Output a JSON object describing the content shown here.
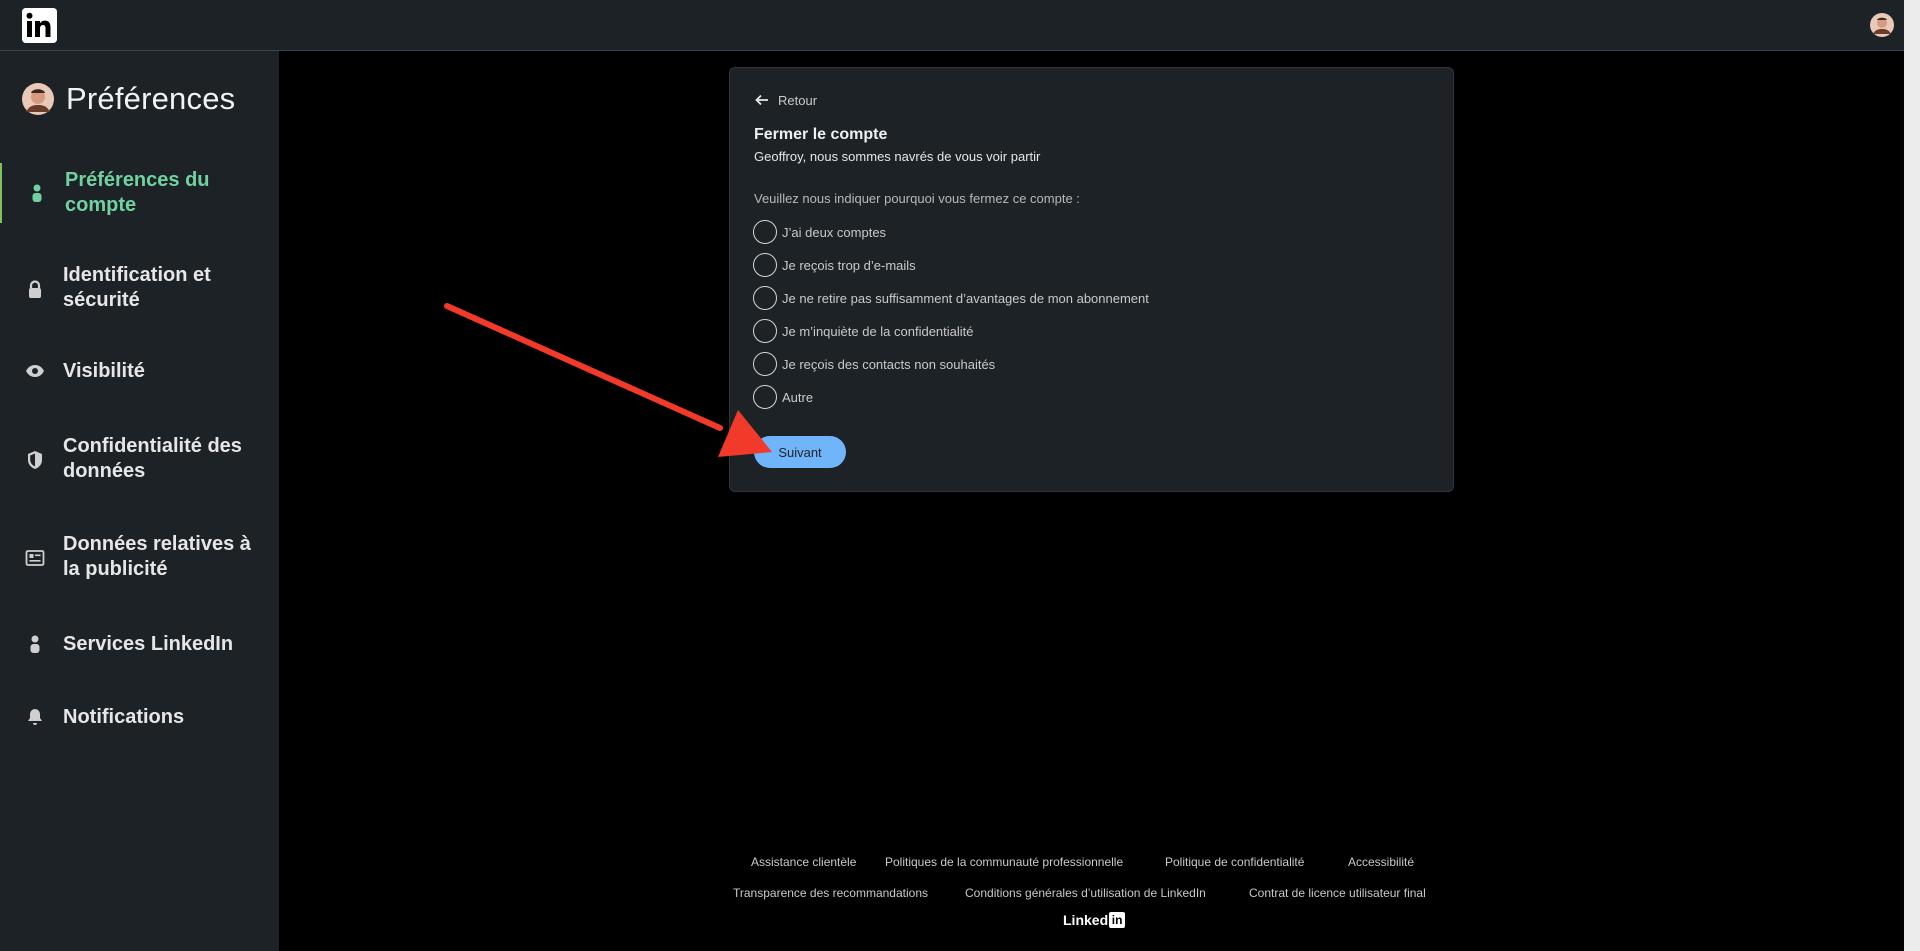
{
  "sidebar": {
    "title": "Préférences",
    "items": [
      {
        "label": "Préférences du compte",
        "icon": "person-icon",
        "active": true
      },
      {
        "label": "Identification et sécurité",
        "icon": "lock-icon"
      },
      {
        "label": "Visibilité",
        "icon": "eye-icon"
      },
      {
        "label": "Confidentialité des données",
        "icon": "shield-icon"
      },
      {
        "label": "Données relatives à la publicité",
        "icon": "newspaper-icon"
      },
      {
        "label": "Services LinkedIn",
        "icon": "person-icon"
      },
      {
        "label": "Notifications",
        "icon": "bell-icon"
      }
    ]
  },
  "card": {
    "back_label": "Retour",
    "title": "Fermer le compte",
    "subtitle": "Geoffroy, nous sommes navrés de vous voir partir",
    "prompt": "Veuillez nous indiquer pourquoi vous fermez ce compte :",
    "options": [
      "J’ai deux comptes",
      "Je reçois trop d’e-mails",
      "Je ne retire pas suffisamment d’avantages de mon abonnement",
      "Je m’inquiète de la confidentialité",
      "Je reçois des contacts non souhaités",
      "Autre"
    ],
    "next_label": "Suivant"
  },
  "footer": {
    "row1": [
      "Assistance clientèle",
      "Politiques de la communauté professionnelle",
      "Politique de confidentialité",
      "Accessibilité"
    ],
    "row2": [
      "Transparence des recommandations",
      "Conditions générales d’utilisation de LinkedIn",
      "Contrat de licence utilisateur final"
    ],
    "brand": "Linked",
    "brand_box": "in"
  },
  "colors": {
    "accent_green": "#71d1a0",
    "button_blue": "#70b5f9",
    "arrow_red": "#f23a2a"
  }
}
